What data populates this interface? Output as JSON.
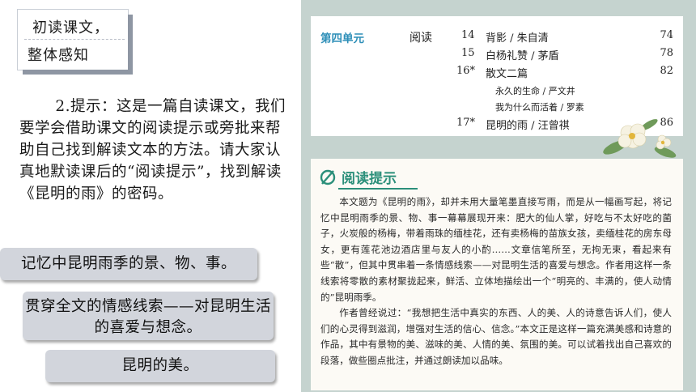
{
  "label_box": {
    "line1": "初读课文，",
    "line2": "整体感知"
  },
  "paragraph": "2.提示：这是一篇自读课文，我们要学会借助课文的阅读提示或旁批来帮助自己找到解读文本的方法。请大家认真地默读课后的“阅读提示”，找到解读《昆明的雨》的密码。",
  "callouts": [
    "记忆中昆明雨季的景、物、事。",
    "贯穿全文的情感线索——对昆明生活的喜爱与想念。",
    "昆明的美。"
  ],
  "toc": {
    "unit": "第四单元",
    "category": "阅读",
    "entries": [
      {
        "num": "14",
        "title": "背影 / 朱自清",
        "page": "74"
      },
      {
        "num": "15",
        "title": "白杨礼赞 / 茅盾",
        "page": "78"
      },
      {
        "num": "16*",
        "title": "散文二篇",
        "page": "82"
      },
      {
        "num": "",
        "title": "永久的生命 / 严文井",
        "page": ""
      },
      {
        "num": "",
        "title": "我为什么而活着 / 罗素",
        "page": ""
      },
      {
        "num": "17*",
        "title": "昆明的雨 / 汪曾祺",
        "page": "86"
      }
    ]
  },
  "tips": {
    "title": "阅读提示",
    "p1": "本文题为《昆明的雨》，却并未用大量笔墨直接写雨，而是从一幅画写起，将记忆中昆明雨季的景、物、事一幕幕展现开来：肥大的仙人掌，好吃与不太好吃的菌子，火炭般的杨梅，带着雨珠的缅桂花，还有卖杨梅的苗族女孩，卖缅桂花的房东母女，更有莲花池边酒店里与友人的小酌……文章信笔所至，无拘无束，看起来有些“散”，但其中贯串着一条情感线索——对昆明生活的喜爱与想念。作者用这样一条线索将零散的素材聚拢起来，鲜活、立体地描绘出一个“明亮的、丰满的，使人动情的”昆明雨季。",
    "p2": "作者曾经说过：“我想把生活中真实的东西、人的美、人的诗意告诉人们，使人们的心灵得到滋润，增强对生活的信心、信念。”本文正是这样一篇充满美感和诗意的作品，其中有景物的美、滋味的美、人情的美、氛围的美。可以试着找出自己喜欢的段落，做些圈点批注，并通过朗读加以品味。"
  },
  "colors": {
    "unit_blue": "#2e8fb8",
    "tips_green": "#2b8f7a",
    "panel_bg": "#c5d3cf",
    "callout_bg": "#d2d5dc"
  }
}
